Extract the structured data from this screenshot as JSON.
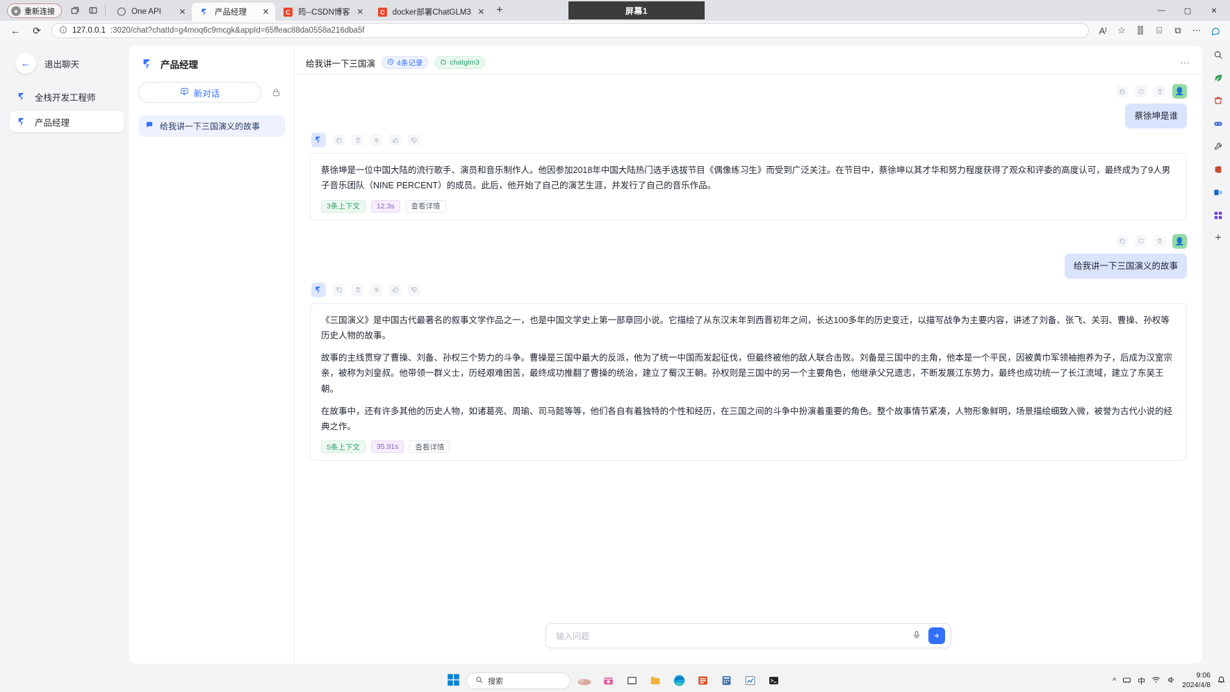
{
  "browser": {
    "profile": {
      "label": "重新连接",
      "icon": "person-icon"
    },
    "icons": {
      "workspaces": "workspaces-icon",
      "split": "split-screen-icon",
      "newtab": "+",
      "sep": ""
    },
    "tabs": [
      {
        "title": "One API",
        "favicon": "openai-icon",
        "active": false,
        "close": "✕"
      },
      {
        "title": "产品经理",
        "favicon": "fastgpt-icon",
        "active": true,
        "close": "✕"
      },
      {
        "title": "筠--CSDN博客",
        "favicon": "csdn-icon",
        "active": false,
        "close": "✕"
      },
      {
        "title": "docker部署ChatGLM3",
        "favicon": "csdn-icon",
        "active": false,
        "close": "✕"
      }
    ],
    "screen_overlay": {
      "label": "屏幕1"
    },
    "window_controls": {
      "minimize": "—",
      "maximize": "▢",
      "close": "✕"
    },
    "omnibox": {
      "back": "←",
      "reload": "⟳",
      "info_icon": "info-icon",
      "host": "127.0.0.1",
      "path": ":3020/chat?chatId=g4moq6c9mcgk&appId=65ffeac88da0558a216dba5f",
      "read_aloud": "Aᴵ",
      "favorite": "☆",
      "split": "⫿⫿",
      "collections": "⌸",
      "extensions": "⧉",
      "more": "⋯",
      "copilot": "copilot-icon"
    }
  },
  "app": {
    "exit": {
      "label": "退出聊天",
      "icon": "arrow-left-icon"
    },
    "items": [
      {
        "label": "全栈开发工程师",
        "icon": "fastgpt-icon",
        "active": false
      },
      {
        "label": "产品经理",
        "icon": "fastgpt-icon",
        "active": true
      }
    ]
  },
  "conversations": {
    "app_title": "产品经理",
    "new_chat": {
      "label": "新对话",
      "icon": "chat-plus-icon"
    },
    "history_icon": "history-icon",
    "items": [
      {
        "label": "给我讲一下三国演义的故事",
        "icon": "chat-bubble-icon",
        "active": true
      }
    ]
  },
  "chat": {
    "header": {
      "title": "给我讲一下三国演",
      "records_chip": {
        "label": "4条记录",
        "icon": "clock-icon"
      },
      "model_chip": {
        "label": "chatglm3",
        "icon": "model-icon"
      },
      "more": "⋯"
    },
    "action_icons": [
      "copy-icon",
      "retry-icon",
      "delete-icon"
    ],
    "ai_action_icons": [
      "copy-icon",
      "delete-icon",
      "speak-icon",
      "thumbs-up-icon",
      "thumbs-down-icon"
    ],
    "messages": [
      {
        "role": "user",
        "text": "蔡徐坤是谁",
        "avatar": "user-avatar"
      },
      {
        "role": "ai",
        "avatar": "fastgpt-icon",
        "paragraphs": [
          "蔡徐坤是一位中国大陆的流行歌手、演员和音乐制作人。他因参加2018年中国大陆热门选手选拔节目《偶像练习生》而受到广泛关注。在节目中，蔡徐坤以其才华和努力程度获得了观众和评委的高度认可，最终成为了9人男子音乐团队（NINE PERCENT）的成员。此后，他开始了自己的演艺生涯，并发行了自己的音乐作品。"
        ],
        "footer": {
          "context": "3条上下文",
          "time": "12.3s",
          "detail": "查看详情"
        }
      },
      {
        "role": "user",
        "text": "给我讲一下三国演义的故事",
        "avatar": "user-avatar"
      },
      {
        "role": "ai",
        "avatar": "fastgpt-icon",
        "paragraphs": [
          "《三国演义》是中国古代最著名的叙事文学作品之一，也是中国文学史上第一部章回小说。它描绘了从东汉末年到西晋初年之间，长达100多年的历史变迁，以描写战争为主要内容，讲述了刘备、张飞、关羽、曹操、孙权等历史人物的故事。",
          "故事的主线贯穿了曹操、刘备、孙权三个势力的斗争。曹操是三国中最大的反派，他为了统一中国而发起征伐，但最终被他的敌人联合击败。刘备是三国中的主角，他本是一个平民，因被黄巾军领袖抱养为子，后成为汉室宗亲，被称为刘皇叔。他带领一群义士，历经艰难困苦，最终成功推翻了曹操的统治，建立了蜀汉王朝。孙权则是三国中的另一个主要角色，他继承父兄遗志，不断发展江东势力，最终也成功统一了长江流域，建立了东吴王朝。",
          "在故事中，还有许多其他的历史人物，如诸葛亮、周瑜、司马懿等等，他们各自有着独特的个性和经历，在三国之间的斗争中扮演着重要的角色。整个故事情节紧凑，人物形象鲜明，场景描绘细致入微，被誉为古代小说的经典之作。"
        ],
        "footer": {
          "context": "5条上下文",
          "time": "35.91s",
          "detail": "查看详情"
        }
      }
    ],
    "composer": {
      "placeholder": "输入问题",
      "mic_icon": "microphone-icon",
      "send_icon": "send-icon"
    }
  },
  "rail": {
    "icons": [
      "search-icon",
      "leaf-icon",
      "shopping-icon",
      "games-icon",
      "tools-icon",
      "office-icon",
      "outlook-icon",
      "app-icon",
      "add-icon"
    ]
  },
  "taskbar": {
    "start_icon": "windows-icon",
    "search": {
      "label": "搜索",
      "icon": "search-icon"
    },
    "apps": [
      "weather-icon",
      "store-icon",
      "explorer-icon",
      "folder-icon",
      "edge-icon",
      "office-icon",
      "calc-icon",
      "chart-icon",
      "terminal-icon"
    ],
    "tray": {
      "chevron": "^",
      "network": "network-icon",
      "ime": "中",
      "wifi": "wifi-icon",
      "volume": "volume-icon"
    },
    "clock": {
      "time": "9:06",
      "date": "2024/4/8"
    },
    "notification_icon": "notification-icon"
  },
  "colors": {
    "accent": "#3370ff",
    "user_bubble": "#dbe4fd",
    "green": "#2aa36b",
    "purple": "#8b5cd6"
  }
}
